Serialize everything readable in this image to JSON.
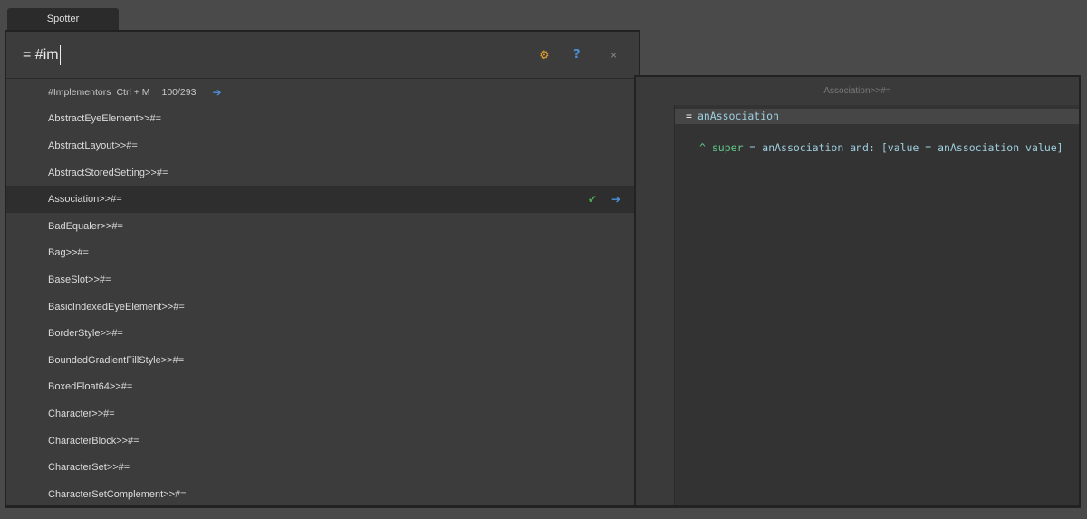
{
  "window": {
    "tab_title": "Spotter"
  },
  "search": {
    "value": "= #im"
  },
  "toolbar": {
    "settings_icon": "wrench-icon",
    "help_label": "?",
    "close_label": "×"
  },
  "results": {
    "header": {
      "category": "#Implementors",
      "shortcut": "Ctrl + M",
      "count": "100/293"
    },
    "items": [
      "AbstractEyeElement>>#=",
      "AbstractLayout>>#=",
      "AbstractStoredSetting>>#=",
      "Association>>#=",
      "BadEqualer>>#=",
      "Bag>>#=",
      "BaseSlot>>#=",
      "BasicIndexedEyeElement>>#=",
      "BorderStyle>>#=",
      "BoundedGradientFillStyle>>#=",
      "BoxedFloat64>>#=",
      "Character>>#=",
      "CharacterBlock>>#=",
      "CharacterSet>>#=",
      "CharacterSetComplement>>#="
    ],
    "selected_index": 3
  },
  "preview": {
    "title": "Association>>#=",
    "line1_op": "=",
    "line1_arg": "anAssociation",
    "line2": {
      "caret": "^",
      "super": "super",
      "rest1": " = anAssociation and: [value = anAssociation value]"
    }
  },
  "colors": {
    "background": "#4a4a4a",
    "panel": "#3c3c3c",
    "selected": "#2e2e2e",
    "accent_blue": "#4a90d9",
    "check_green": "#4caf50"
  }
}
